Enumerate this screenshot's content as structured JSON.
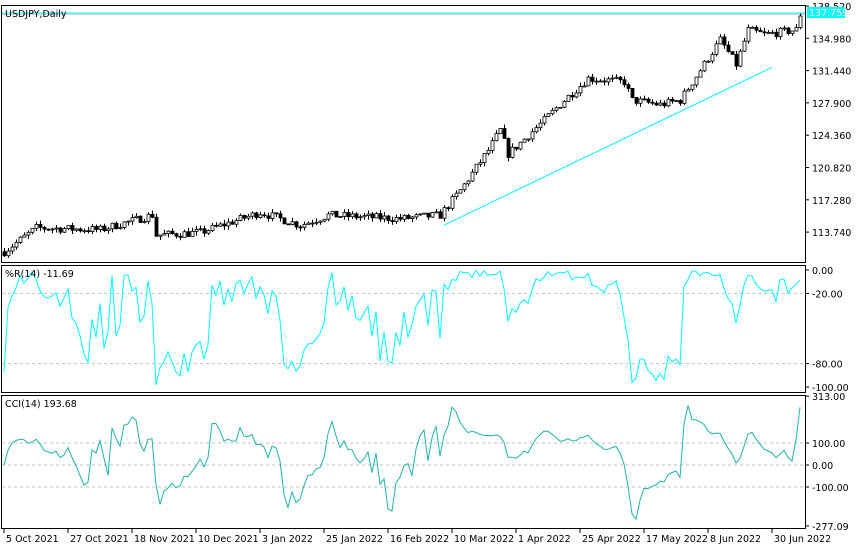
{
  "symbol_label": "USDJPY,Daily",
  "current_price": "137.759",
  "colors": {
    "accent": "#00ffff",
    "cci": "#20b2aa",
    "grid": "#c0c0c0"
  },
  "price_axis": [
    "138.520",
    "134.980",
    "131.440",
    "127.900",
    "124.360",
    "120.820",
    "117.280",
    "113.740"
  ],
  "price_axis_values": [
    138.52,
    134.98,
    131.44,
    127.9,
    124.36,
    120.82,
    117.28,
    113.74
  ],
  "wpr": {
    "label": "%R(14) -11.69",
    "axis": [
      "0.00",
      "-20.00",
      "-80.00",
      "-100.00"
    ],
    "axis_values": [
      0,
      -20,
      -80,
      -100
    ]
  },
  "cci": {
    "label": "CCI(14) 193.68",
    "axis": [
      "313.00",
      "100.00",
      "0.00",
      "-100.00",
      "-277.09"
    ],
    "axis_values": [
      313,
      100,
      0,
      -100,
      -277.09
    ]
  },
  "dates": [
    "5 Oct 2021",
    "27 Oct 2021",
    "18 Nov 2021",
    "10 Dec 2021",
    "3 Jan 2022",
    "25 Jan 2022",
    "16 Feb 2022",
    "10 Mar 2022",
    "1 Apr 2022",
    "25 Apr 2022",
    "17 May 2022",
    "8 Jun 2022",
    "30 Jun 2022"
  ],
  "price_path": [
    [
      0,
      111.6
    ],
    [
      8,
      114.2
    ],
    [
      24,
      114.0
    ],
    [
      37,
      115.6
    ],
    [
      38,
      113.4
    ],
    [
      49,
      113.7
    ],
    [
      64,
      115.9
    ],
    [
      74,
      114.5
    ],
    [
      81,
      115.6
    ],
    [
      99,
      115.2
    ],
    [
      109,
      115.6
    ],
    [
      114,
      118.3
    ],
    [
      121,
      122.7
    ],
    [
      124,
      124.9
    ],
    [
      126,
      122.3
    ],
    [
      135,
      126.0
    ],
    [
      140,
      128.2
    ],
    [
      146,
      130.6
    ],
    [
      155,
      130.2
    ],
    [
      157,
      128.2
    ],
    [
      164,
      127.7
    ],
    [
      169,
      128.2
    ],
    [
      174,
      131.5
    ],
    [
      179,
      134.8
    ],
    [
      183,
      132.1
    ],
    [
      186,
      135.9
    ],
    [
      190,
      135.4
    ],
    [
      198,
      135.9
    ],
    [
      199,
      137.6
    ]
  ],
  "trendline": {
    "from": [
      110,
      114.5
    ],
    "to": [
      192,
      131.8
    ]
  }
}
